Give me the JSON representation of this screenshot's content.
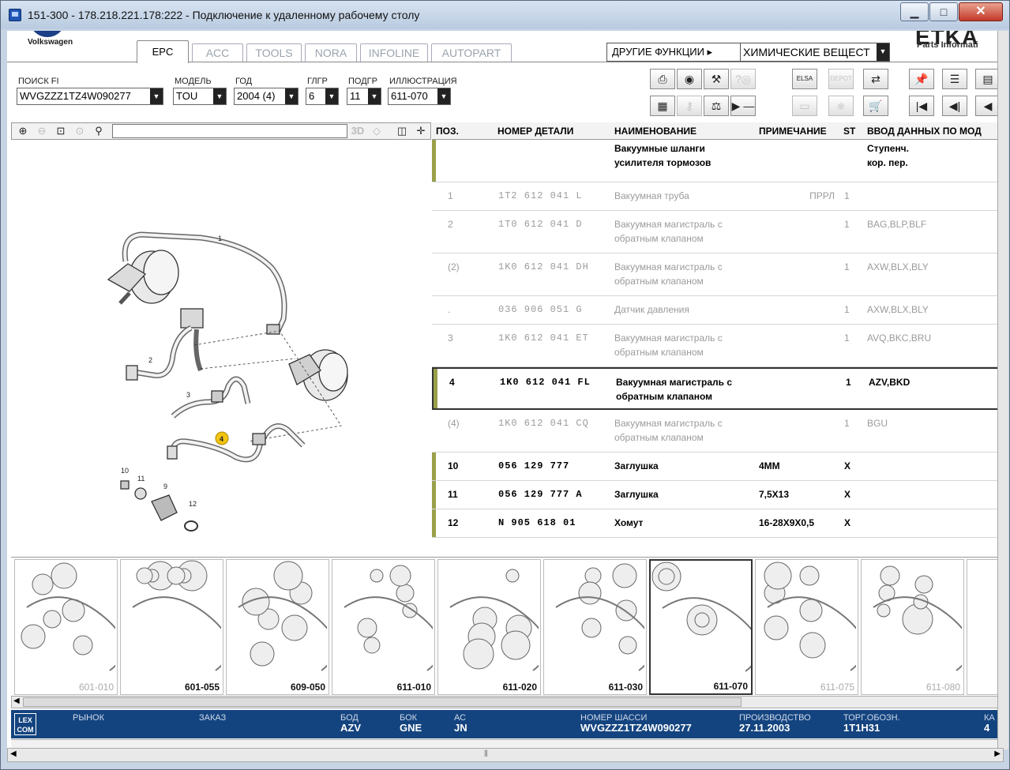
{
  "window": {
    "title": "151-300 - 178.218.221.178:222 - Подключение к удаленному рабочему столу",
    "min_glyph": "▁",
    "max_glyph": "□",
    "close_glyph": "✕"
  },
  "brand": {
    "vw": "Volkswagen",
    "etka": "ETKA",
    "etka_sub": "Parts Informati"
  },
  "tabs": [
    {
      "label": "EPC",
      "active": true
    },
    {
      "label": "ACC"
    },
    {
      "label": "TOOLS"
    },
    {
      "label": "NORA"
    },
    {
      "label": "INFOLINE"
    },
    {
      "label": "AUTOPART"
    }
  ],
  "other_functions": {
    "label": "ДРУГИЕ ФУНКЦИИ ▸",
    "selected": "ХИМИЧЕСКИЕ ВЕЩЕСТ"
  },
  "filters": {
    "search_fi": {
      "label": "ПОИСК FI",
      "value": "WVGZZZ1TZ4W090277"
    },
    "model": {
      "label": "МОДЕЛЬ",
      "value": "TOU"
    },
    "year": {
      "label": "ГОД",
      "value": "2004 (4)"
    },
    "main_group": {
      "label": "ГЛГР",
      "value": "6"
    },
    "sub_group": {
      "label": "ПОДГР",
      "value": "11"
    },
    "illustration": {
      "label": "ИЛЛЮСТРАЦИЯ",
      "value": "611-070"
    }
  },
  "toolbar_icons": [
    {
      "name": "print-icon",
      "glyph": "⎙"
    },
    {
      "name": "catalog-icon",
      "glyph": "◉"
    },
    {
      "name": "tools-icon",
      "glyph": "⚒"
    },
    {
      "name": "help-icon",
      "glyph": "?◎"
    },
    {
      "name": "elsa-icon",
      "glyph": "ELSA"
    },
    {
      "name": "depot-icon",
      "glyph": "DEPOT"
    },
    {
      "name": "cart-transfer-icon",
      "glyph": "⇄"
    },
    {
      "name": "pin-icon",
      "glyph": "📌"
    },
    {
      "name": "list-icon",
      "glyph": "☰"
    },
    {
      "name": "document-icon",
      "glyph": "▤"
    },
    {
      "name": "table-icon",
      "glyph": "▦"
    },
    {
      "name": "key-icon",
      "glyph": "⚷"
    },
    {
      "name": "scale-icon",
      "glyph": "⚖"
    },
    {
      "name": "play-minus-icon",
      "glyph": "▶ —"
    },
    {
      "name": "display-icon",
      "glyph": "▭"
    },
    {
      "name": "stamp-icon",
      "glyph": "⎈"
    },
    {
      "name": "shopping-cart-icon",
      "glyph": "🛒"
    },
    {
      "name": "first-page-icon",
      "glyph": "|◀"
    },
    {
      "name": "prev-page-icon",
      "glyph": "◀|"
    },
    {
      "name": "back-icon",
      "glyph": "◀"
    }
  ],
  "viewer_tools": {
    "zoom_in": "⊕",
    "zoom_out": "⊖",
    "zoom_area": "⊡",
    "zoom_100": "⊙",
    "magnifier": "⚲",
    "view_3d": "3D",
    "split": "◫",
    "cross": "✛"
  },
  "parts_table": {
    "headers": {
      "pos": "ПОЗ.",
      "part_no": "НОМЕР ДЕТАЛИ",
      "name": "НАИМЕНОВАНИЕ",
      "note": "ПРИМЕЧАНИЕ",
      "st": "ST",
      "model_data": "ВВОД ДАННЫХ ПО МОД"
    },
    "group_row": {
      "name_1": "Вакуумные шланги",
      "name_2": "усилителя тормозов",
      "model_1": "Ступенч.",
      "model_2": "кор. пер."
    },
    "rows": [
      {
        "pos": "1",
        "part_no": "1T2 612 041 L",
        "name_1": "Вакуумная труба",
        "name_2": "",
        "note": "ПРРЛ",
        "st": "1",
        "model": "",
        "state": "grey"
      },
      {
        "pos": "2",
        "part_no": "1T0 612 041 D",
        "name_1": "Вакуумная магистраль с",
        "name_2": "обратным клапаном",
        "note": "",
        "st": "1",
        "model": "BAG,BLP,BLF",
        "state": "grey"
      },
      {
        "pos": "(2)",
        "part_no": "1K0 612 041 DH",
        "name_1": "Вакуумная магистраль с",
        "name_2": "обратным клапаном",
        "note": "",
        "st": "1",
        "model": "AXW,BLX,BLY",
        "state": "grey"
      },
      {
        "pos": ".",
        "part_no": "036 906 051 G",
        "name_1": "Датчик давления",
        "name_2": "",
        "note": "",
        "st": "1",
        "model": "AXW,BLX,BLY",
        "state": "grey"
      },
      {
        "pos": "3",
        "part_no": "1K0 612 041 ET",
        "name_1": "Вакуумная магистраль с",
        "name_2": "обратным клапаном",
        "note": "",
        "st": "1",
        "model": "AVQ,BKC,BRU",
        "state": "grey"
      },
      {
        "pos": "4",
        "part_no": "1K0 612 041 FL",
        "name_1": "Вакуумная магистраль с",
        "name_2": "обратным клапаном",
        "note": "",
        "st": "1",
        "model": "AZV,BKD",
        "state": "selected"
      },
      {
        "pos": "(4)",
        "part_no": "1K0 612 041 CQ",
        "name_1": "Вакуумная магистраль с",
        "name_2": "обратным клапаном",
        "note": "",
        "st": "1",
        "model": "BGU",
        "state": "grey"
      },
      {
        "pos": "10",
        "part_no": "056 129 777",
        "name_1": "Заглушка",
        "name_2": "",
        "note": "4MM",
        "st": "X",
        "model": "",
        "state": "bold"
      },
      {
        "pos": "11",
        "part_no": "056 129 777 A",
        "name_1": "Заглушка",
        "name_2": "",
        "note": "7,5X13",
        "st": "X",
        "model": "",
        "state": "bold"
      },
      {
        "pos": "12",
        "part_no": "N    905 618 01",
        "name_1": "Хомут",
        "name_2": "",
        "note": "16-28X9X0,5",
        "st": "X",
        "model": "",
        "state": "bold"
      }
    ]
  },
  "drawing_callouts": [
    "1",
    "2",
    "3",
    "4",
    "9",
    "10",
    "11",
    "12"
  ],
  "thumbnails": [
    {
      "label": "601-010",
      "style": "grey"
    },
    {
      "label": "601-055",
      "style": "bold"
    },
    {
      "label": "609-050",
      "style": "bold"
    },
    {
      "label": "611-010",
      "style": "bold"
    },
    {
      "label": "611-020",
      "style": "bold"
    },
    {
      "label": "611-030",
      "style": "bold"
    },
    {
      "label": "611-070",
      "style": "selected"
    },
    {
      "label": "611-075",
      "style": "grey"
    },
    {
      "label": "611-080",
      "style": "grey"
    }
  ],
  "status": {
    "logo_1": "LEX",
    "logo_2": "COM",
    "market": {
      "label": "РЫНОК",
      "value": ""
    },
    "order": {
      "label": "ЗАКАЗ",
      "value": ""
    },
    "engine": {
      "label": "БОД",
      "value": "AZV"
    },
    "gearbox": {
      "label": "БОК",
      "value": "GNE"
    },
    "ac": {
      "label": "АС",
      "value": "JN"
    },
    "chassis": {
      "label": "НОМЕР ШАССИ",
      "value": "WVGZZZ1TZ4W090277"
    },
    "production": {
      "label": "ПРОИЗВОДСТВО",
      "value": "27.11.2003"
    },
    "trade": {
      "label": "ТОРГ.ОБОЗН.",
      "value": "1T1H31"
    },
    "ka": {
      "label": "КА",
      "value": "4"
    }
  },
  "scroll": {
    "left_glyph": "◀",
    "right_glyph": "▶",
    "grip_glyph": "⦀"
  },
  "colors": {
    "status_bg": "#14447f",
    "row_bar": "#9aa04a",
    "callout": "#f2c40f"
  }
}
